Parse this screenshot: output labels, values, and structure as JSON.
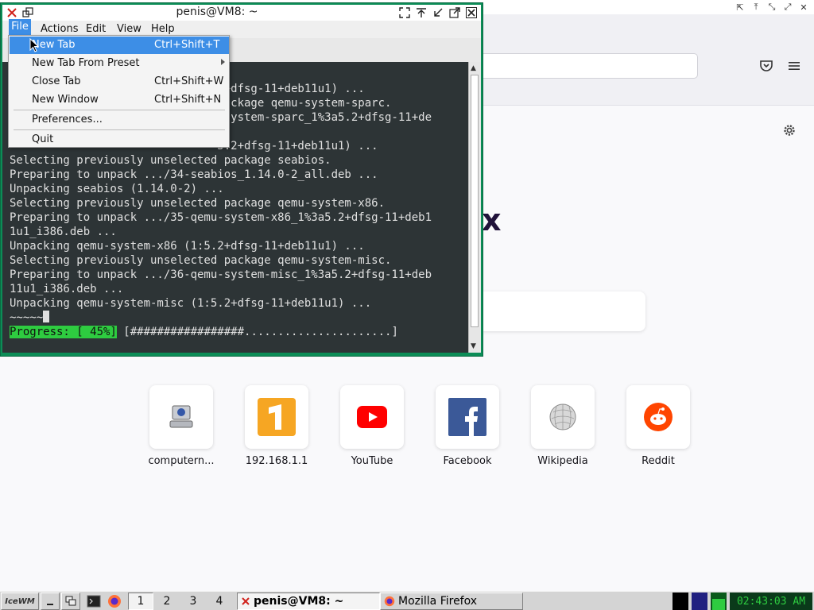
{
  "terminal": {
    "title": "penis@VM8: ~",
    "menus": [
      "File",
      "Actions",
      "Edit",
      "View",
      "Help"
    ],
    "lines": [
      "                               2+dfsg-11+deb11u1) ...",
      "                               package qemu-system-sparc.",
      "                               -system-sparc_1%3a5.2+dfsg-11+de",
      "",
      "                               5.2+dfsg-11+deb11u1) ...",
      "Selecting previously unselected package seabios.",
      "Preparing to unpack .../34-seabios_1.14.0-2_all.deb ...",
      "Unpacking seabios (1.14.0-2) ...",
      "Selecting previously unselected package qemu-system-x86.",
      "Preparing to unpack .../35-qemu-system-x86_1%3a5.2+dfsg-11+deb1",
      "1u1_i386.deb ...",
      "Unpacking qemu-system-x86 (1:5.2+dfsg-11+deb11u1) ...",
      "Selecting previously unselected package qemu-system-misc.",
      "Preparing to unpack .../36-qemu-system-misc_1%3a5.2+dfsg-11+deb",
      "11u1_i386.deb ...",
      "Unpacking qemu-system-misc (1:5.2+dfsg-11+deb11u1) ...",
      "~~~~~"
    ],
    "progress_label": "Progress: [ 45%]",
    "progress_bar": "[#################......................]",
    "progress_percent": 45
  },
  "file_menu": {
    "items": [
      {
        "label": "New Tab",
        "shortcut": "Ctrl+Shift+T"
      },
      {
        "label": "New Tab From Preset",
        "shortcut": ""
      },
      {
        "label": "Close Tab",
        "shortcut": "Ctrl+Shift+W"
      },
      {
        "label": "New Window",
        "shortcut": "Ctrl+Shift+N"
      },
      {
        "label": "Preferences...",
        "shortcut": ""
      },
      {
        "label": "Quit",
        "shortcut": ""
      }
    ]
  },
  "firefox": {
    "logo_fragment": "x",
    "shortcuts": [
      {
        "label": "computern...",
        "icon": "computer-icon"
      },
      {
        "label": "192.168.1.1",
        "icon": "router-icon"
      },
      {
        "label": "YouTube",
        "icon": "youtube-icon"
      },
      {
        "label": "Facebook",
        "icon": "facebook-icon"
      },
      {
        "label": "Wikipedia",
        "icon": "wikipedia-icon"
      },
      {
        "label": "Reddit",
        "icon": "reddit-icon"
      }
    ]
  },
  "taskbar": {
    "start_label": "IceWM",
    "workspaces": [
      "1",
      "2",
      "3",
      "4"
    ],
    "tasks": [
      {
        "label": "penis@VM8: ~"
      },
      {
        "label": "Mozilla Firefox"
      }
    ],
    "clock": "02:43:03 AM"
  },
  "colors": {
    "terminal_bg": "#2d3436",
    "progress_green": "#2ecc40",
    "menu_highlight": "#3d8ee6",
    "window_border": "#0c8d57"
  }
}
